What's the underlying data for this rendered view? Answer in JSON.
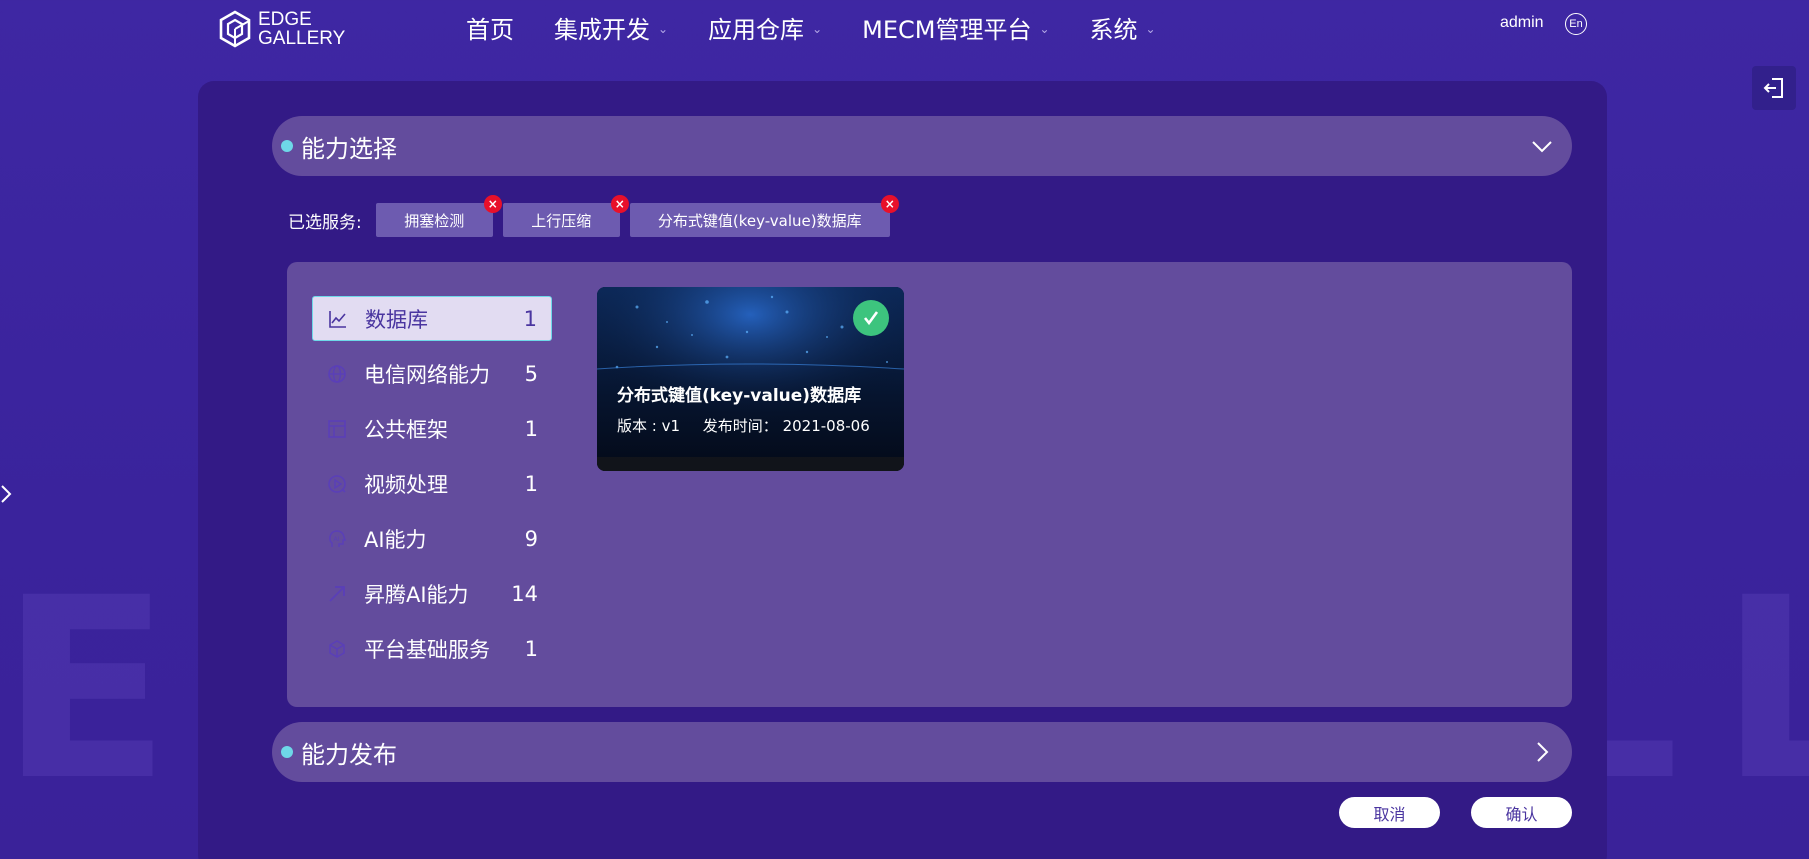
{
  "watermark": "EDGE GALLERY",
  "header": {
    "logo_text_line1": "EDGE",
    "logo_text_line2": "GALLERY",
    "nav": [
      {
        "label": "首页",
        "has_dropdown": false
      },
      {
        "label": "集成开发",
        "has_dropdown": true
      },
      {
        "label": "应用仓库",
        "has_dropdown": true
      },
      {
        "label": "MECM管理平台",
        "has_dropdown": true
      },
      {
        "label": "系统",
        "has_dropdown": true
      }
    ],
    "user": "admin",
    "lang": "En"
  },
  "sections": {
    "select_title": "能力选择",
    "publish_title": "能力发布"
  },
  "selected": {
    "label": "已选服务:",
    "tags": [
      "拥塞检测",
      "上行压缩",
      "分布式键值(key-value)数据库"
    ],
    "remove_glyph": "×"
  },
  "categories": [
    {
      "label": "数据库",
      "count": "1",
      "icon": "line-chart-icon",
      "active": true
    },
    {
      "label": "电信网络能力",
      "count": "5",
      "icon": "globe-icon",
      "active": false
    },
    {
      "label": "公共框架",
      "count": "1",
      "icon": "layout-icon",
      "active": false
    },
    {
      "label": "视频处理",
      "count": "1",
      "icon": "video-play-icon",
      "active": false
    },
    {
      "label": "AI能力",
      "count": "9",
      "icon": "ai-head-icon",
      "active": false
    },
    {
      "label": "昇腾AI能力",
      "count": "14",
      "icon": "arrow-up-right-icon",
      "active": false
    },
    {
      "label": "平台基础服务",
      "count": "1",
      "icon": "cube-icon",
      "active": false
    }
  ],
  "card": {
    "name": "分布式键值(key-value)数据库",
    "version": "版本 : v1",
    "date": "发布时间： 2021-08-06",
    "selected": true
  },
  "buttons": {
    "cancel": "取消",
    "confirm": "确认"
  },
  "colors": {
    "background": "#3d25a0",
    "panel": "#331a86",
    "section": "#634c9d",
    "accent_dot": "#6ed8e8",
    "remove": "#e8102a",
    "check": "#3dc47e"
  }
}
